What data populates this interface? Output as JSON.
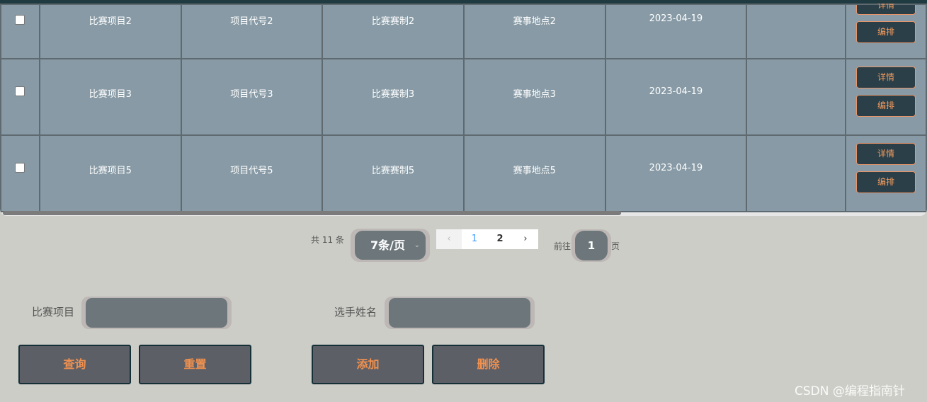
{
  "table": {
    "rows": [
      {
        "project": "比赛项目2",
        "code": "项目代号2",
        "format": "比赛赛制2",
        "venue": "赛事地点2",
        "date": "2023-04-19",
        "extra": ""
      },
      {
        "project": "比赛项目3",
        "code": "项目代号3",
        "format": "比赛赛制3",
        "venue": "赛事地点3",
        "date": "2023-04-19",
        "extra": ""
      },
      {
        "project": "比赛项目5",
        "code": "项目代号5",
        "format": "比赛赛制5",
        "venue": "赛事地点5",
        "date": "2023-04-19",
        "extra": ""
      }
    ],
    "detail_label": "详情",
    "arrange_label": "编排"
  },
  "pagination": {
    "total": "共 11 条",
    "page_size": "7条/页",
    "pages": [
      "1",
      "2"
    ],
    "current": "1",
    "goto_prefix": "前往",
    "goto_value": "1",
    "goto_suffix": "页",
    "prev_icon": "chevron-left-icon",
    "next_icon": "chevron-right-icon"
  },
  "search": {
    "project_label": "比赛项目",
    "player_label": "选手姓名"
  },
  "actions": {
    "query": "查询",
    "reset": "重置",
    "add": "添加",
    "delete": "删除"
  },
  "watermark": "CSDN @编程指南针",
  "colors": {
    "cell_bg": "#879aa5",
    "button_text": "#f0914f",
    "action_bg": "#5d5f67"
  }
}
